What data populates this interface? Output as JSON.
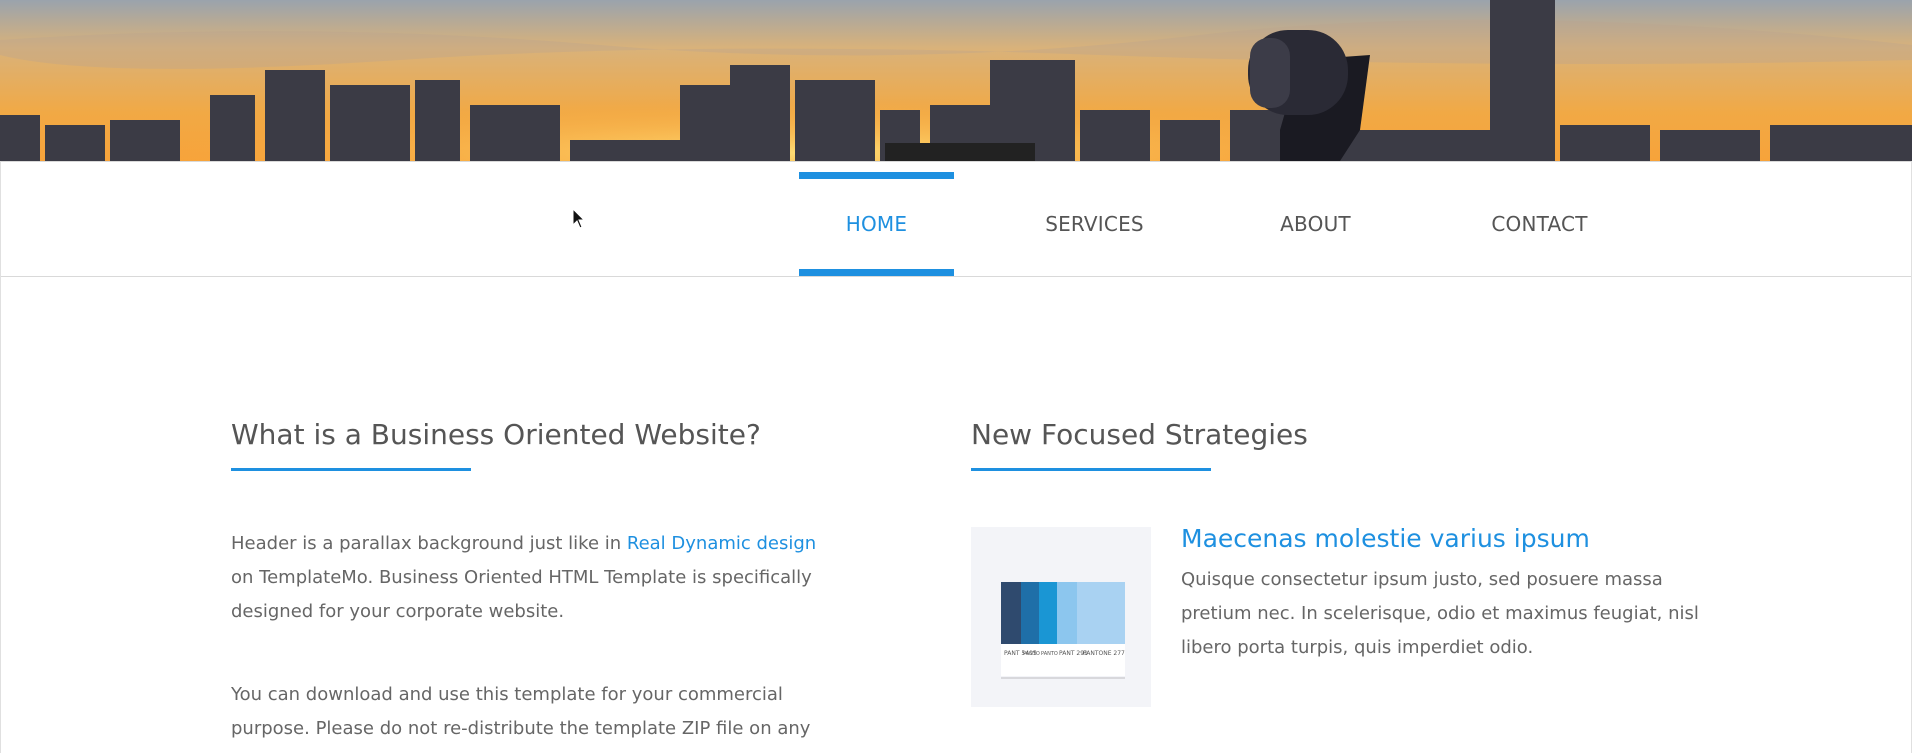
{
  "nav": {
    "items": [
      {
        "label": "HOME",
        "active": true
      },
      {
        "label": "SERVICES",
        "active": false
      },
      {
        "label": "ABOUT",
        "active": false
      },
      {
        "label": "CONTACT",
        "active": false
      }
    ]
  },
  "left": {
    "title": "What is a Business Oriented Website?",
    "p1_before": "Header is a parallax background just like in ",
    "p1_link": "Real Dynamic design",
    "p1_after": " on TemplateMo. Business Oriented HTML Template is specifically designed for your corporate website.",
    "p2": "You can download and use this template for your commercial purpose. Please do not re-distribute the template ZIP file on any"
  },
  "right": {
    "title": "New Focused Strategies",
    "post": {
      "title": "Maecenas molestie varius ipsum",
      "body": "Quisque consectetur ipsum justo, sed posuere massa pretium nec. In scelerisque, odio et maximus feugiat, nisl libero porta turpis, quis imperdiet odio.",
      "thumbnail_labels": [
        "PANT 5405",
        "PANTO",
        "PANTO",
        "PANT 291",
        "PANTONE 277"
      ]
    }
  },
  "colors": {
    "accent": "#1e90e0",
    "text": "#666666"
  }
}
